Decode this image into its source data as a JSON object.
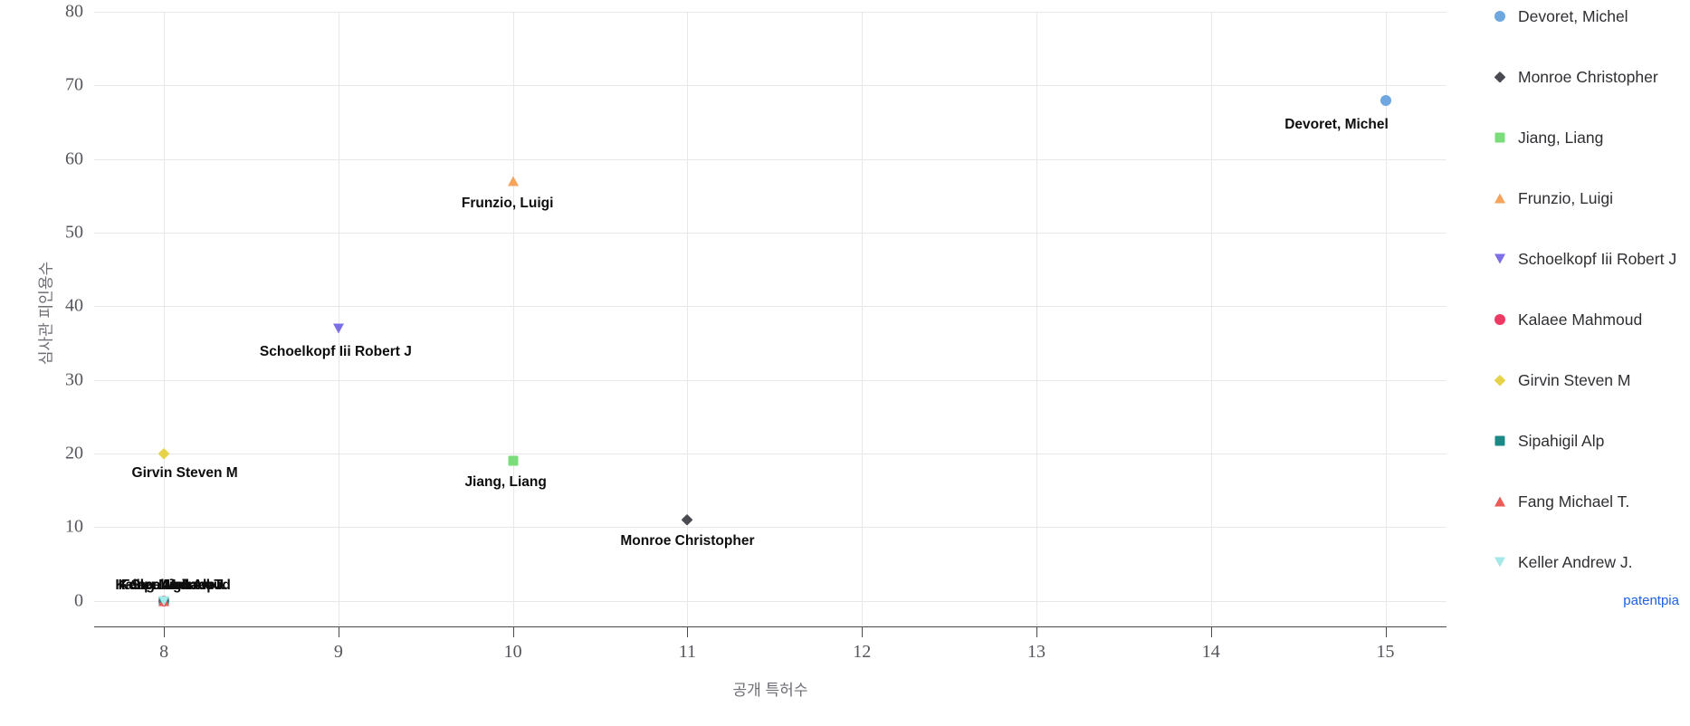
{
  "chart_data": {
    "type": "scatter",
    "title": "",
    "xlabel": "공개 특허수",
    "ylabel": "심사관 피인용수",
    "xlim": [
      7.6,
      15.35
    ],
    "ylim": [
      -3.5,
      80
    ],
    "grid": true,
    "legend_position": "right",
    "x_ticks": [
      "8",
      "9",
      "10",
      "11",
      "12",
      "13",
      "14",
      "15"
    ],
    "x_tick_values": [
      8,
      9,
      10,
      11,
      12,
      13,
      14,
      15
    ],
    "y_ticks": [
      "0",
      "10",
      "20",
      "30",
      "40",
      "50",
      "60",
      "70",
      "80"
    ],
    "y_tick_values": [
      0,
      10,
      20,
      30,
      40,
      50,
      60,
      70,
      80
    ],
    "points": [
      {
        "name": "Devoret, Michel",
        "x": 15,
        "y": 68,
        "marker": "circle",
        "color": "#6fa8e0",
        "label_dx": -54,
        "label_dy": 18
      },
      {
        "name": "Monroe Christopher",
        "x": 11,
        "y": 11,
        "marker": "diamond",
        "color": "#4a4a52",
        "label_dx": 0,
        "label_dy": 15
      },
      {
        "name": "Jiang, Liang",
        "x": 10,
        "y": 19,
        "marker": "square",
        "color": "#79dd79",
        "label_dx": -8,
        "label_dy": 15
      },
      {
        "name": "Frunzio, Luigi",
        "x": 10,
        "y": 57,
        "marker": "tri-up",
        "color": "#f6a35c",
        "label_dx": -6,
        "label_dy": 16
      },
      {
        "name": "Schoelkopf Iii Robert J",
        "x": 9,
        "y": 37,
        "marker": "tri-down",
        "color": "#7b6fe8",
        "label_dx": -3,
        "label_dy": 17
      },
      {
        "name": "Kalaee Mahmoud",
        "x": 8,
        "y": 0,
        "marker": "circle",
        "color": "#ee3a63",
        "label_dx": 10,
        "label_dy": -26
      },
      {
        "name": "Girvin Steven M",
        "x": 8,
        "y": 20,
        "marker": "diamond",
        "color": "#e6d34a",
        "label_dx": 23,
        "label_dy": 13
      },
      {
        "name": "Sipahigil Alp",
        "x": 8,
        "y": 0,
        "marker": "square",
        "color": "#1b8a87",
        "label_dx": 10,
        "label_dy": -26
      },
      {
        "name": "Fang Michael T.",
        "x": 8,
        "y": 0,
        "marker": "tri-up",
        "color": "#ec5b56",
        "label_dx": 10,
        "label_dy": -26
      },
      {
        "name": "Keller Andrew J.",
        "x": 8,
        "y": 0,
        "marker": "tri-down",
        "color": "#a5e8e8",
        "label_dx": 10,
        "label_dy": -26
      }
    ]
  },
  "legend": {
    "items": [
      {
        "label": "Devoret, Michel",
        "marker": "circle",
        "color": "#6fa8e0"
      },
      {
        "label": "Monroe Christopher",
        "marker": "diamond",
        "color": "#4a4a52"
      },
      {
        "label": "Jiang, Liang",
        "marker": "square",
        "color": "#79dd79"
      },
      {
        "label": "Frunzio, Luigi",
        "marker": "tri-up",
        "color": "#f6a35c"
      },
      {
        "label": "Schoelkopf Iii Robert J",
        "marker": "tri-down",
        "color": "#7b6fe8"
      },
      {
        "label": "Kalaee Mahmoud",
        "marker": "circle",
        "color": "#ee3a63"
      },
      {
        "label": "Girvin Steven M",
        "marker": "diamond",
        "color": "#e6d34a"
      },
      {
        "label": "Sipahigil Alp",
        "marker": "square",
        "color": "#1b8a87"
      },
      {
        "label": "Fang Michael T.",
        "marker": "tri-up",
        "color": "#ec5b56"
      },
      {
        "label": "Keller Andrew J.",
        "marker": "tri-down",
        "color": "#a5e8e8"
      }
    ]
  },
  "watermark": {
    "text": "patentpia",
    "color": "#1f5fe0"
  }
}
